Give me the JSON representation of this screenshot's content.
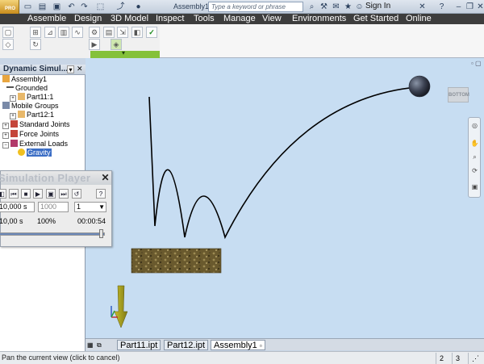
{
  "titlebar": {
    "app_badge": "PRO",
    "document": "Assembly1",
    "search_placeholder": "Type a keyword or phrase",
    "sign_in": "Sign In"
  },
  "menu_tabs": [
    "Assemble",
    "Design",
    "3D Model",
    "Inspect",
    "Tools",
    "Manage",
    "View",
    "Environments",
    "Get Started",
    "Online"
  ],
  "browser": {
    "title": "Dynamic Simul...",
    "items": {
      "assembly": "Assembly1",
      "grounded": "Grounded",
      "part11": "Part11:1",
      "mobile_groups": "Mobile Groups",
      "part12": "Part12:1",
      "standard_joints": "Standard Joints",
      "force_joints": "Force Joints",
      "external_loads": "External Loads",
      "gravity": "Gravity"
    }
  },
  "sim_player": {
    "title": "Simulation Player",
    "end_time": "10,000 s",
    "images": "1000",
    "filter": "1",
    "elapsed": "10,00 s",
    "percent": "100%",
    "clock": "00:00:54",
    "progress": 1.0
  },
  "viewcube": {
    "label": "BOTTOM"
  },
  "doc_tabs": [
    "Part11.ipt",
    "Part12.ipt",
    "Assembly1"
  ],
  "status": {
    "message": "Pan the current view (click to cancel)",
    "count_a": "2",
    "count_b": "3"
  },
  "colors": {
    "viewport": "#c7ddf2",
    "ribbon_accent": "#84c13a",
    "selection": "#3c6ec5"
  }
}
